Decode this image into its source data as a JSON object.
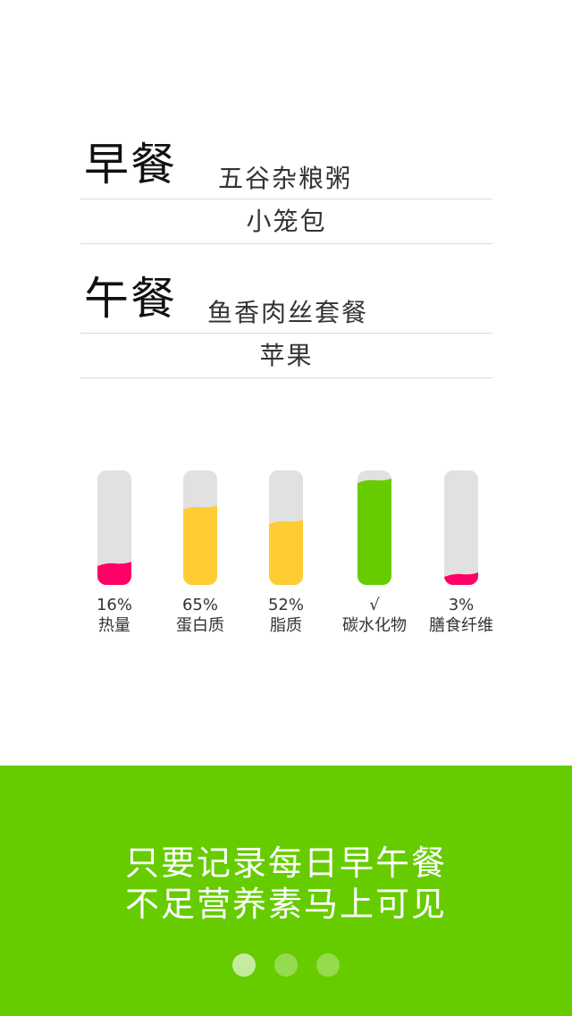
{
  "meals": {
    "breakfast": {
      "title": "早餐",
      "items": [
        "五谷杂粮粥",
        "小笼包"
      ]
    },
    "lunch": {
      "title": "午餐",
      "items": [
        "鱼香肉丝套餐",
        "苹果"
      ]
    }
  },
  "nutrients": [
    {
      "label": "热量",
      "value_text": "16%",
      "fill": 0.16,
      "color": "#ff0066"
    },
    {
      "label": "蛋白质",
      "value_text": "65%",
      "fill": 0.65,
      "color": "#ffcc33"
    },
    {
      "label": "脂质",
      "value_text": "52%",
      "fill": 0.52,
      "color": "#ffcc33"
    },
    {
      "label": "碳水化物",
      "value_text": "√",
      "fill": 0.88,
      "color": "#66cc00"
    },
    {
      "label": "膳食纤维",
      "value_text": "3%",
      "fill": 0.06,
      "color": "#ff0066"
    }
  ],
  "banner": {
    "line1": "只要记录每日早午餐",
    "line2": "不足营养素马上可见",
    "background": "#66cc00",
    "pager": {
      "count": 3,
      "active": 0
    }
  }
}
